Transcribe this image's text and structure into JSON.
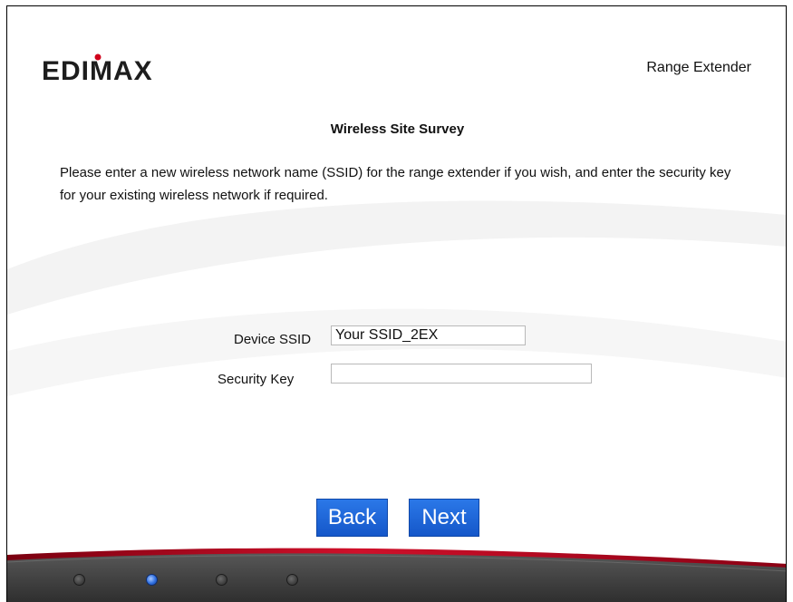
{
  "header": {
    "logo_text": "EDIMAX",
    "logo_icon": "edimax-logo",
    "product_name": "Range Extender"
  },
  "main": {
    "title": "Wireless Site Survey",
    "instructions": "Please enter a new wireless network name (SSID) for the range extender if you wish, and enter the security key for your existing wireless network if required."
  },
  "form": {
    "device_ssid_label": "Device SSID",
    "device_ssid_value": "Your SSID_2EX",
    "security_key_label": "Security Key",
    "security_key_value": ""
  },
  "buttons": {
    "back_label": "Back",
    "next_label": "Next"
  },
  "progress": {
    "total_steps": 4,
    "current_step": 2
  },
  "colors": {
    "button_blue": "#1d64d8",
    "accent_red": "#c8102e",
    "footer_dark": "#3a3a3a"
  }
}
